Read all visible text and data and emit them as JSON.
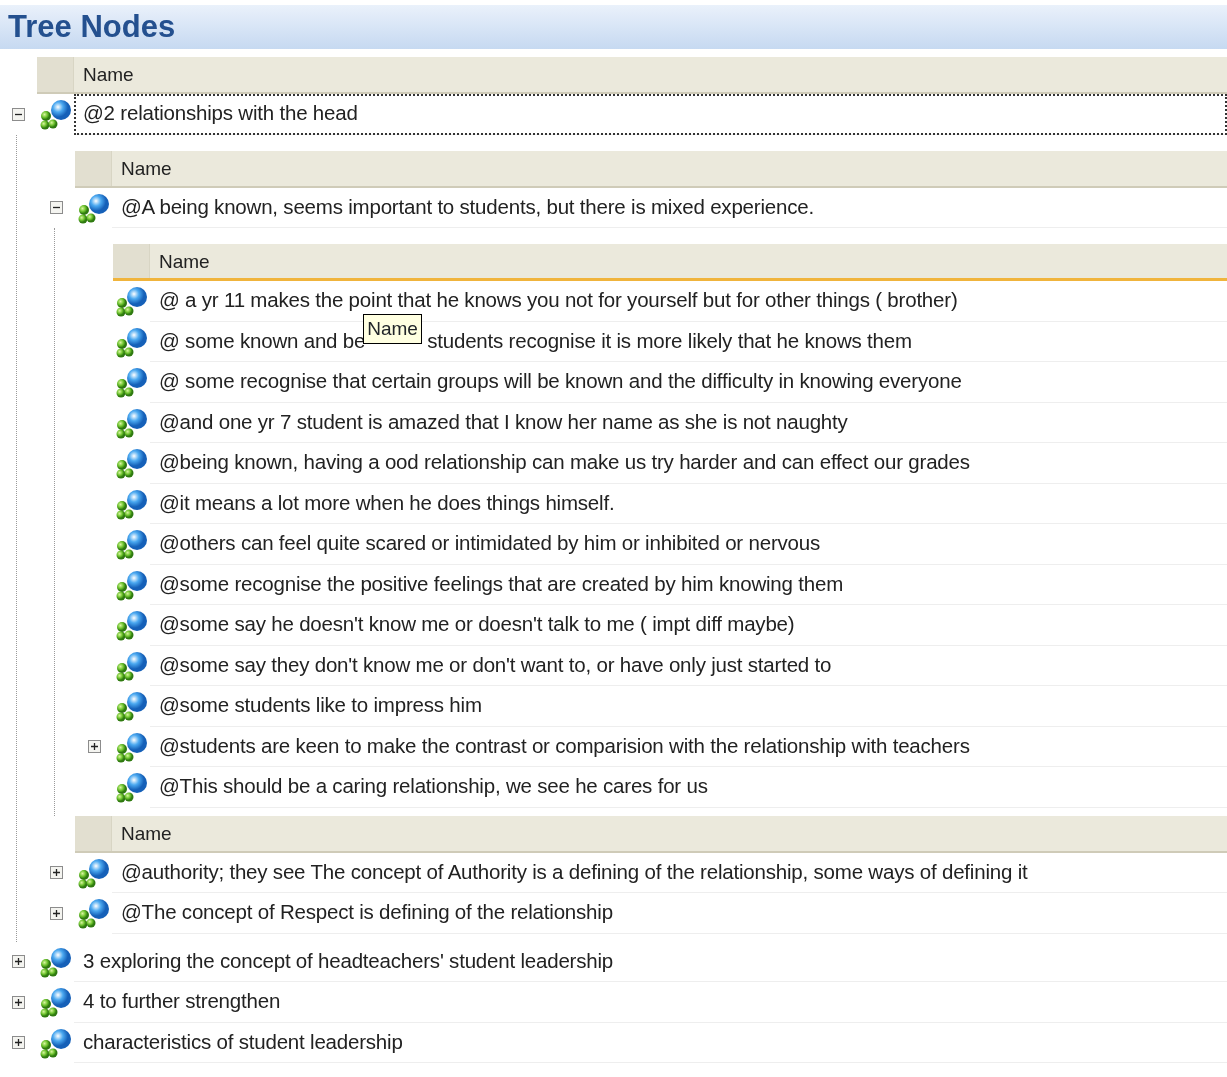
{
  "panel": {
    "title": "Tree Nodes"
  },
  "tree": {
    "bands": [
      {
        "header": "Name",
        "hot": false,
        "rows": [
          {
            "text": "@2 relationships with the head",
            "kind": "folder",
            "expanded": true,
            "selected": true,
            "bands": [
              {
                "header": "Name",
                "hot": false,
                "rows": [
                  {
                    "text": "@A being known, seems important to students, but there is mixed experience.",
                    "kind": "folder",
                    "expanded": true,
                    "selected": false,
                    "bands": [
                      {
                        "header": "Name",
                        "hot": true,
                        "rows": [
                          {
                            "text": "@ a yr 11 makes the point that he knows you not for yourself but for other things ( brother)",
                            "kind": "leaf",
                            "selected": false
                          },
                          {
                            "text_parts": [
                              "@ some known and be",
                              "students recognise it is more likely that he knows them"
                            ],
                            "tooltip": "Name",
                            "kind": "leaf",
                            "selected": false
                          },
                          {
                            "text": "@ some recognise that certain groups will be known and the difficulty in knowing everyone",
                            "kind": "leaf",
                            "selected": false
                          },
                          {
                            "text": "@and one yr 7 student is amazed that I know her name as she is not naughty",
                            "kind": "leaf",
                            "selected": false
                          },
                          {
                            "text": "@being known, having a ood relationship can make us try harder and can effect our grades",
                            "kind": "leaf",
                            "selected": false
                          },
                          {
                            "text": "@it means a lot more when he does things himself.",
                            "kind": "leaf",
                            "selected": false
                          },
                          {
                            "text": "@others can feel quite scared or intimidated by him or inhibited or nervous",
                            "kind": "leaf",
                            "selected": false
                          },
                          {
                            "text": "@some recognise the positive feelings that are created by him knowing them",
                            "kind": "leaf",
                            "selected": false
                          },
                          {
                            "text": "@some say he doesn't know me or doesn't talk to me ( impt diff maybe)",
                            "kind": "leaf",
                            "selected": false
                          },
                          {
                            "text": "@some say they don't know me or don't want to, or have only just started to",
                            "kind": "leaf",
                            "selected": false
                          },
                          {
                            "text": "@some students like to impress him",
                            "kind": "leaf",
                            "selected": false
                          },
                          {
                            "text": "@students are keen to make the contrast or comparision with the relationship with teachers",
                            "kind": "folder",
                            "expanded": false,
                            "selected": false
                          },
                          {
                            "text": "@This should be a caring relationship, we see he cares for us",
                            "kind": "leaf",
                            "selected": false
                          }
                        ]
                      }
                    ]
                  }
                ]
              },
              {
                "header": "Name",
                "hot": false,
                "rows": [
                  {
                    "text": "@authority; they see The concept of Authority is a defining of the relationship, some ways of defining it",
                    "kind": "folder",
                    "expanded": false,
                    "selected": false
                  },
                  {
                    "text": "@The concept of Respect is defining of the relationship",
                    "kind": "folder",
                    "expanded": false,
                    "selected": false
                  }
                ]
              }
            ]
          },
          {
            "text": "3 exploring the concept of headteachers' student leadership",
            "kind": "folder",
            "expanded": false,
            "selected": false
          },
          {
            "text": "4 to further strengthen",
            "kind": "folder",
            "expanded": false,
            "selected": false
          },
          {
            "text": "characteristics of student leadership",
            "kind": "folder",
            "expanded": false,
            "selected": false
          }
        ]
      }
    ]
  }
}
